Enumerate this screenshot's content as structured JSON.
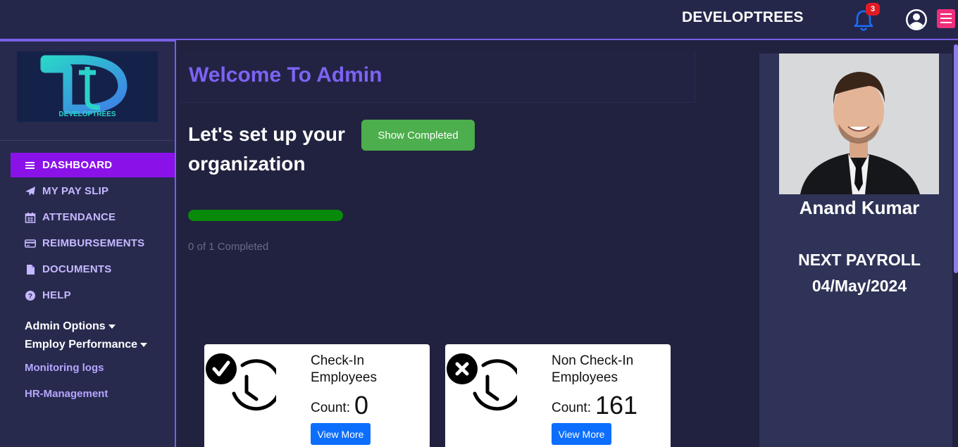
{
  "header": {
    "brand": "DEVELOPTREES",
    "notification_count": "3",
    "icons": [
      "bell-icon",
      "user-circle-icon",
      "hamburger-menu-icon"
    ]
  },
  "sidebar": {
    "logo_text": "DEVELOPTREES",
    "items": [
      {
        "label": "DASHBOARD",
        "icon": "bars-icon",
        "active": true
      },
      {
        "label": "MY PAY SLIP",
        "icon": "paper-plane-icon"
      },
      {
        "label": "ATTENDANCE",
        "icon": "calendar-icon"
      },
      {
        "label": "REIMBURSEMENTS",
        "icon": "credit-card-icon"
      },
      {
        "label": "DOCUMENTS",
        "icon": "file-icon"
      },
      {
        "label": "HELP",
        "icon": "question-circle-icon"
      }
    ],
    "admin_options": "Admin Options",
    "employ_performance": "Employ Performance",
    "monitoring_logs": "Monitoring logs",
    "hr_management": "HR-Management"
  },
  "main": {
    "welcome": "Welcome To Admin",
    "setup_title": "Let's set up your organization",
    "show_completed": "Show Completed",
    "progress_value": 0,
    "progress_text": "0 of 1 Completed",
    "cards": [
      {
        "label": "Check-In Employees",
        "count_label": "Count:",
        "count": "0",
        "button": "View More",
        "icon": "clock-check-icon"
      },
      {
        "label": "Non Check-In Employees",
        "count_label": "Count:",
        "count": "161",
        "button": "View More",
        "icon": "clock-x-icon"
      }
    ]
  },
  "profile": {
    "name": "Anand Kumar",
    "payroll_label": "NEXT PAYROLL",
    "payroll_date": "04/May/2024"
  },
  "colors": {
    "accent": "#7a5fe8",
    "active_nav": "#8a12e9",
    "success": "#4cae4c",
    "progress": "#0a8a0a",
    "primary_button": "#0d6efd"
  }
}
